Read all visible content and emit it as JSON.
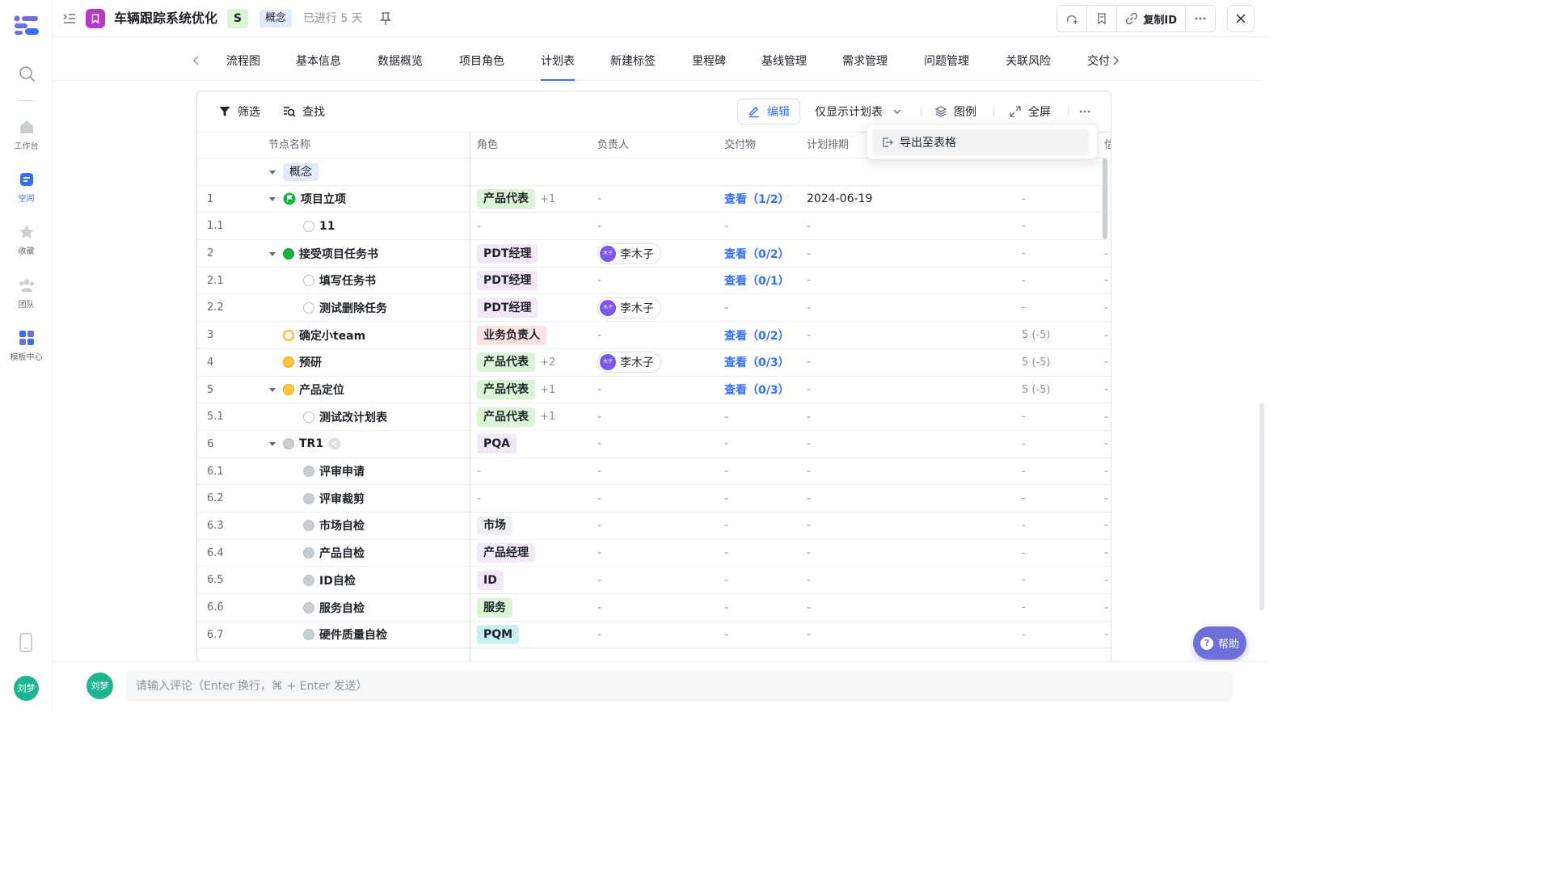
{
  "rail": {
    "items": [
      {
        "label": "工作台",
        "icon": "home-icon"
      },
      {
        "label": "空间",
        "icon": "space-icon"
      },
      {
        "label": "收藏",
        "icon": "star-icon"
      },
      {
        "label": "团队",
        "icon": "team-icon"
      },
      {
        "label": "模板中心",
        "icon": "template-icon"
      }
    ],
    "user_initials": "刘梦"
  },
  "header": {
    "title": "车辆跟踪系统优化",
    "badge": "S",
    "stage": "概念",
    "days": "已进行 5 天",
    "copy_id_label": "复制ID"
  },
  "tabs": [
    "流程图",
    "基本信息",
    "数据概览",
    "项目角色",
    "计划表",
    "新建标签",
    "里程碑",
    "基线管理",
    "需求管理",
    "问题管理",
    "关联风险",
    "交付"
  ],
  "active_tab": "计划表",
  "toolbar": {
    "filter": "筛选",
    "find": "查找",
    "edit": "编辑",
    "view_mode": "仅显示计划表",
    "legend": "图例",
    "fullscreen": "全屏"
  },
  "dropdown": {
    "export": "导出至表格"
  },
  "columns": [
    "节点名称",
    "角色",
    "负责人",
    "交付物",
    "计划排期",
    "信"
  ],
  "group_label": "概念",
  "rows": [
    {
      "no": "1",
      "name": "项目立项",
      "level": 1,
      "caret": true,
      "status": "flag",
      "role": "产品代表",
      "role_color": "#d9f5d6",
      "role_plus": "+1",
      "owner": "-",
      "deliverable": "查看（1/2）",
      "schedule": "2024-06-19",
      "extra": "-"
    },
    {
      "no": "1.1",
      "name": "11",
      "level": 2,
      "caret": false,
      "status": "empty",
      "role": "-",
      "role_color": "",
      "role_plus": "",
      "owner": "-",
      "deliverable": "-",
      "schedule": "-",
      "extra": "-"
    },
    {
      "no": "2",
      "name": "接受项目任务书",
      "level": 1,
      "caret": true,
      "status": "green",
      "role": "PDT经理",
      "role_color": "#f3e8fa",
      "role_plus": "",
      "owner": "李木子",
      "deliverable": "查看（0/2）",
      "schedule": "-",
      "extra": "-"
    },
    {
      "no": "2.1",
      "name": "填写任务书",
      "level": 2,
      "caret": false,
      "status": "empty",
      "role": "PDT经理",
      "role_color": "#f3e8fa",
      "role_plus": "",
      "owner": "-",
      "deliverable": "查看（0/1）",
      "schedule": "-",
      "extra": "-"
    },
    {
      "no": "2.2",
      "name": "测试删除任务",
      "level": 2,
      "caret": false,
      "status": "empty",
      "role": "PDT经理",
      "role_color": "#f3e8fa",
      "role_plus": "",
      "owner": "李木子",
      "deliverable": "-",
      "schedule": "-",
      "extra": "-"
    },
    {
      "no": "3",
      "name": "确定小team",
      "level": 1,
      "caret": false,
      "status": "yellow-ring",
      "role": "业务负责人",
      "role_color": "#fde2e2",
      "role_plus": "",
      "owner": "-",
      "deliverable": "查看（0/2）",
      "schedule": "-",
      "extra": "5 (-5)"
    },
    {
      "no": "4",
      "name": "预研",
      "level": 1,
      "caret": false,
      "status": "yellow",
      "role": "产品代表",
      "role_color": "#d9f5d6",
      "role_plus": "+2",
      "owner": "李木子",
      "deliverable": "查看（0/3）",
      "schedule": "-",
      "extra": "5 (-5)"
    },
    {
      "no": "5",
      "name": "产品定位",
      "level": 1,
      "caret": true,
      "status": "yellow",
      "role": "产品代表",
      "role_color": "#d9f5d6",
      "role_plus": "+1",
      "owner": "-",
      "deliverable": "查看（0/3）",
      "schedule": "-",
      "extra": "5 (-5)"
    },
    {
      "no": "5.1",
      "name": "测试改计划表",
      "level": 2,
      "caret": false,
      "status": "empty",
      "role": "产品代表",
      "role_color": "#d9f5d6",
      "role_plus": "+1",
      "owner": "-",
      "deliverable": "-",
      "schedule": "-",
      "extra": "-"
    },
    {
      "no": "6",
      "name": "TR1",
      "level": 1,
      "caret": true,
      "status": "gray",
      "role": "PQA",
      "role_color": "#f3e8fa",
      "role_plus": "",
      "owner": "-",
      "deliverable": "-",
      "schedule": "-",
      "extra": "-"
    },
    {
      "no": "6.1",
      "name": "评审申请",
      "level": 2,
      "caret": false,
      "status": "gray",
      "role": "-",
      "role_color": "",
      "role_plus": "",
      "owner": "-",
      "deliverable": "-",
      "schedule": "-",
      "extra": "-"
    },
    {
      "no": "6.2",
      "name": "评审裁剪",
      "level": 2,
      "caret": false,
      "status": "gray",
      "role": "-",
      "role_color": "",
      "role_plus": "",
      "owner": "-",
      "deliverable": "-",
      "schedule": "-",
      "extra": "-"
    },
    {
      "no": "6.3",
      "name": "市场自检",
      "level": 2,
      "caret": false,
      "status": "gray",
      "role": "市场",
      "role_color": "#eef0f3",
      "role_plus": "",
      "owner": "-",
      "deliverable": "-",
      "schedule": "-",
      "extra": "-"
    },
    {
      "no": "6.4",
      "name": "产品自检",
      "level": 2,
      "caret": false,
      "status": "gray",
      "role": "产品经理",
      "role_color": "#f3e8fa",
      "role_plus": "",
      "owner": "-",
      "deliverable": "-",
      "schedule": "-",
      "extra": "-"
    },
    {
      "no": "6.5",
      "name": "ID自检",
      "level": 2,
      "caret": false,
      "status": "gray",
      "role": "ID",
      "role_color": "#f3e8fa",
      "role_plus": "",
      "owner": "-",
      "deliverable": "-",
      "schedule": "-",
      "extra": "-"
    },
    {
      "no": "6.6",
      "name": "服务自检",
      "level": 2,
      "caret": false,
      "status": "gray",
      "role": "服务",
      "role_color": "#d9f5d6",
      "role_plus": "",
      "owner": "-",
      "deliverable": "-",
      "schedule": "-",
      "extra": "-"
    },
    {
      "no": "6.7",
      "name": "硬件质量自检",
      "level": 2,
      "caret": false,
      "status": "gray",
      "role": "PQM",
      "role_color": "#c8f0f0",
      "role_plus": "",
      "owner": "-",
      "deliverable": "-",
      "schedule": "-",
      "extra": "-"
    }
  ],
  "help_label": "帮助",
  "comment": {
    "user": "刘梦",
    "placeholder": "请输入评论（Enter 换行，⌘ + Enter 发送）"
  }
}
